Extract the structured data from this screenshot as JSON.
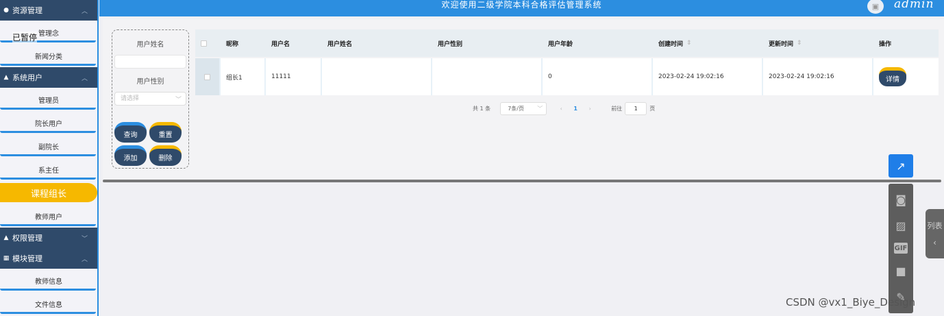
{
  "header": {
    "title": "欢迎使用二级学院本科合格评估管理系统",
    "user": "admin"
  },
  "sidebar": {
    "overlay_tag": "已暂停",
    "groups": [
      {
        "label": "资源管理",
        "icon": "pin-icon",
        "items": [
          "管理念",
          "新闻分类"
        ]
      },
      {
        "label": "系统用户",
        "icon": "user-icon",
        "items": [
          "管理员",
          "院长用户",
          "副院长",
          "系主任",
          "课程组长",
          "教师用户"
        ]
      },
      {
        "label": "权限管理",
        "icon": "user-icon",
        "items": []
      },
      {
        "label": "模块管理",
        "icon": "grid-icon",
        "items": [
          "教师信息",
          "文件信息"
        ]
      }
    ],
    "active_item": "课程组长"
  },
  "search": {
    "name_label": "用户姓名",
    "name_value": "",
    "gender_label": "用户性别",
    "gender_placeholder": "请选择",
    "query_label": "查询",
    "reset_label": "重置",
    "add_label": "添加",
    "delete_label": "删除"
  },
  "table": {
    "columns": [
      "昵称",
      "用户名",
      "用户姓名",
      "用户性别",
      "用户年龄",
      "创建时间",
      "更新时间",
      "操作"
    ],
    "rows": [
      {
        "nickname": "组长1",
        "username": "11111",
        "realname": "",
        "gender": "",
        "age": "0",
        "created": "2023-02-24 19:02:16",
        "updated": "2023-02-24 19:02:16",
        "action": "详情"
      }
    ]
  },
  "pager": {
    "total": "共 1 条",
    "page_size": "7条/页",
    "current": "1",
    "goto_label": "前往",
    "goto_value": "1",
    "page_unit": "页"
  },
  "side_tab": {
    "label": "列表"
  },
  "watermark": "CSDN @vx1_Biye_Design",
  "colors": {
    "primary": "#2c8ee0",
    "accent": "#f6b800",
    "navy": "#2f4a6a"
  }
}
